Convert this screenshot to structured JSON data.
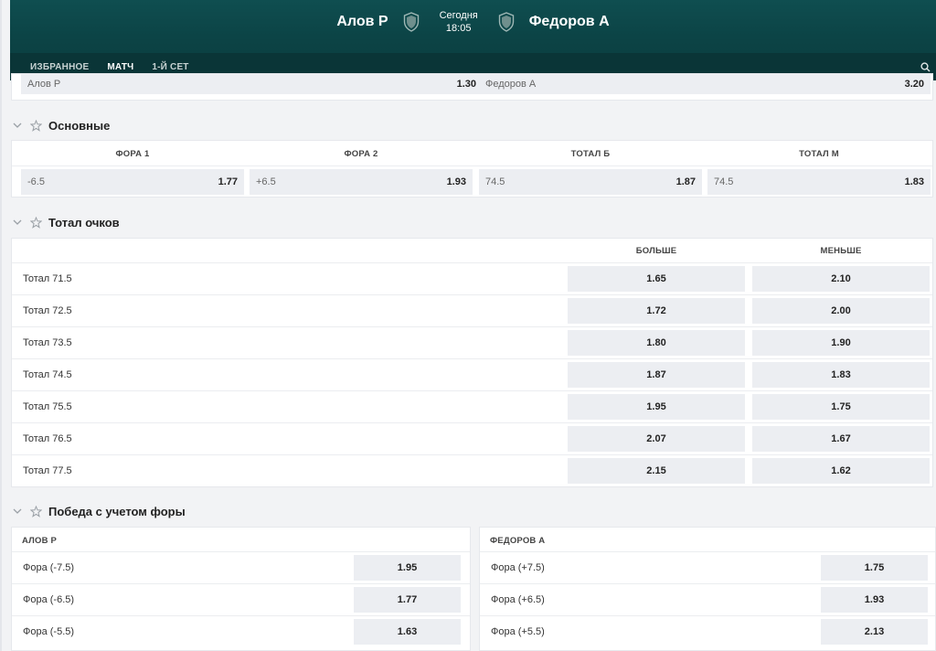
{
  "header": {
    "home_team": "Алов Р",
    "away_team": "Федоров А",
    "date": "Сегодня",
    "time": "18:05",
    "tabs": [
      "ИЗБРАННОЕ",
      "МАТЧ",
      "1-Й СЕТ"
    ]
  },
  "winner": {
    "home_label": "Алов Р",
    "home_odd": "1.30",
    "away_label": "Федоров А",
    "away_odd": "3.20"
  },
  "main": {
    "title": "Основные",
    "columns": [
      "ФОРА 1",
      "ФОРА 2",
      "ТОТАЛ Б",
      "ТОТАЛ М"
    ],
    "cells": [
      {
        "label": "-6.5",
        "odd": "1.77"
      },
      {
        "label": "+6.5",
        "odd": "1.93"
      },
      {
        "label": "74.5",
        "odd": "1.87"
      },
      {
        "label": "74.5",
        "odd": "1.83"
      }
    ]
  },
  "totals": {
    "title": "Тотал очков",
    "over_header": "БОЛЬШЕ",
    "under_header": "МЕНЬШЕ",
    "rows": [
      {
        "label": "Тотал 71.5",
        "over": "1.65",
        "under": "2.10"
      },
      {
        "label": "Тотал 72.5",
        "over": "1.72",
        "under": "2.00"
      },
      {
        "label": "Тотал 73.5",
        "over": "1.80",
        "under": "1.90"
      },
      {
        "label": "Тотал 74.5",
        "over": "1.87",
        "under": "1.83"
      },
      {
        "label": "Тотал 75.5",
        "over": "1.95",
        "under": "1.75"
      },
      {
        "label": "Тотал 76.5",
        "over": "2.07",
        "under": "1.67"
      },
      {
        "label": "Тотал 77.5",
        "over": "2.15",
        "under": "1.62"
      }
    ]
  },
  "handicap": {
    "title": "Победа с учетом форы",
    "left_header": "АЛОВ Р",
    "right_header": "ФЕДОРОВ А",
    "left_rows": [
      {
        "label": "Фора (-7.5)",
        "odd": "1.95"
      },
      {
        "label": "Фора (-6.5)",
        "odd": "1.77"
      },
      {
        "label": "Фора (-5.5)",
        "odd": "1.63"
      }
    ],
    "right_rows": [
      {
        "label": "Фора (+7.5)",
        "odd": "1.75"
      },
      {
        "label": "Фора (+6.5)",
        "odd": "1.93"
      },
      {
        "label": "Фора (+5.5)",
        "odd": "2.13"
      }
    ]
  },
  "colors": {
    "header_bg": "#0c4446",
    "accent": "#1f8a86",
    "odd_bg": "#eceef2"
  },
  "icons": [
    "shield-icon",
    "search-icon",
    "chevron-down-icon",
    "star-icon"
  ]
}
